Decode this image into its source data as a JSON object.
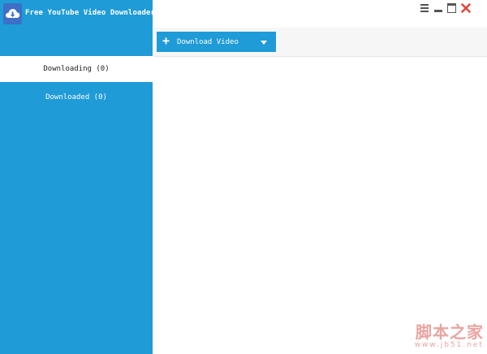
{
  "app": {
    "title": "Free YouTube Video Downloader",
    "accent_color": "#1f9bd7",
    "logo_icon": "cloud-download-icon"
  },
  "sidebar": {
    "items": [
      {
        "label": "Downloading (0)",
        "selected": true
      },
      {
        "label": "Downloaded (0)",
        "selected": false
      }
    ]
  },
  "toolbar": {
    "download_button": {
      "label": "Download Video",
      "icon": "plus-icon",
      "dropdown_icon": "caret-down-icon"
    }
  },
  "window_controls": [
    "menu-icon",
    "minimize-icon",
    "maximize-icon",
    "close-icon"
  ],
  "watermark": {
    "main": "脚本之家",
    "sub": "www.jb51.net"
  }
}
